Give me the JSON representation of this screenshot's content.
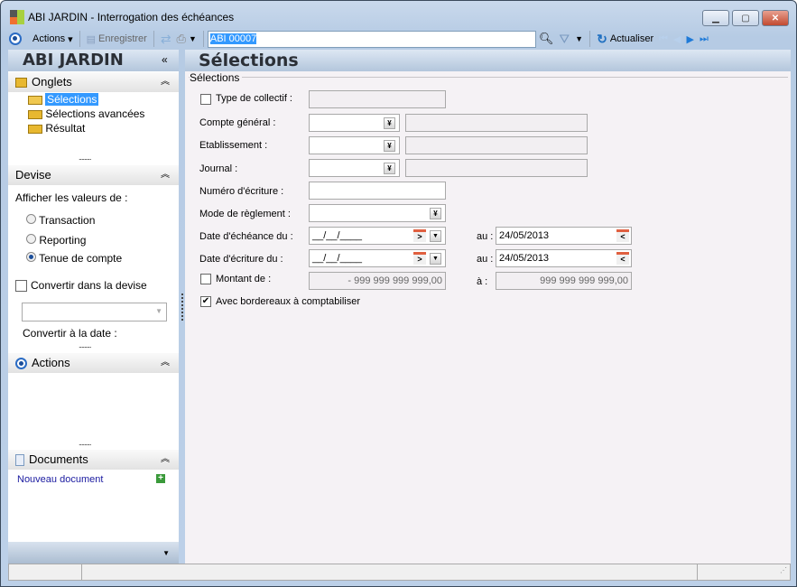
{
  "window": {
    "app": "ABI JARDIN -",
    "title": "Interrogation des échéances"
  },
  "toolbar": {
    "actions": "Actions",
    "save": "Enregistrer",
    "record": "ABI 00007",
    "refresh": "Actualiser"
  },
  "sidebar": {
    "title": "ABI JARDIN",
    "onglets": {
      "title": "Onglets",
      "items": [
        "Sélections",
        "Sélections avancées",
        "Résultat"
      ],
      "selected": 0
    },
    "devise": {
      "title": "Devise",
      "prompt": "Afficher les valeurs de :",
      "options": [
        "Transaction",
        "Reporting",
        "Tenue de compte"
      ],
      "selected": 2,
      "convert_label": "Convertir dans la devise",
      "convert_checked": false,
      "date_label": "Convertir à la date :"
    },
    "actions": {
      "title": "Actions"
    },
    "documents": {
      "title": "Documents",
      "new_doc": "Nouveau document"
    }
  },
  "main": {
    "title": "Sélections",
    "group": "Sélections",
    "type_collectif": {
      "label": "Type de collectif :",
      "checked": false
    },
    "compte_general": {
      "label": "Compte général :"
    },
    "etablissement": {
      "label": "Etablissement :"
    },
    "journal": {
      "label": "Journal :"
    },
    "numero": {
      "label": "Numéro d'écriture :"
    },
    "mode": {
      "label": "Mode de règlement :"
    },
    "date_echeance": {
      "label": "Date d'échéance du :",
      "from": "__/__/____",
      "to_label": "au :",
      "to": "24/05/2013"
    },
    "date_ecriture": {
      "label": "Date d'écriture du :",
      "from": "__/__/____",
      "to_label": "au :",
      "to": "24/05/2013"
    },
    "montant": {
      "label": "Montant de :",
      "checked": false,
      "from": "- 999 999 999 999,00",
      "to_label": "à :",
      "to": "999 999 999 999,00"
    },
    "bordereaux": {
      "label": "Avec bordereaux à comptabiliser",
      "checked": true
    }
  }
}
